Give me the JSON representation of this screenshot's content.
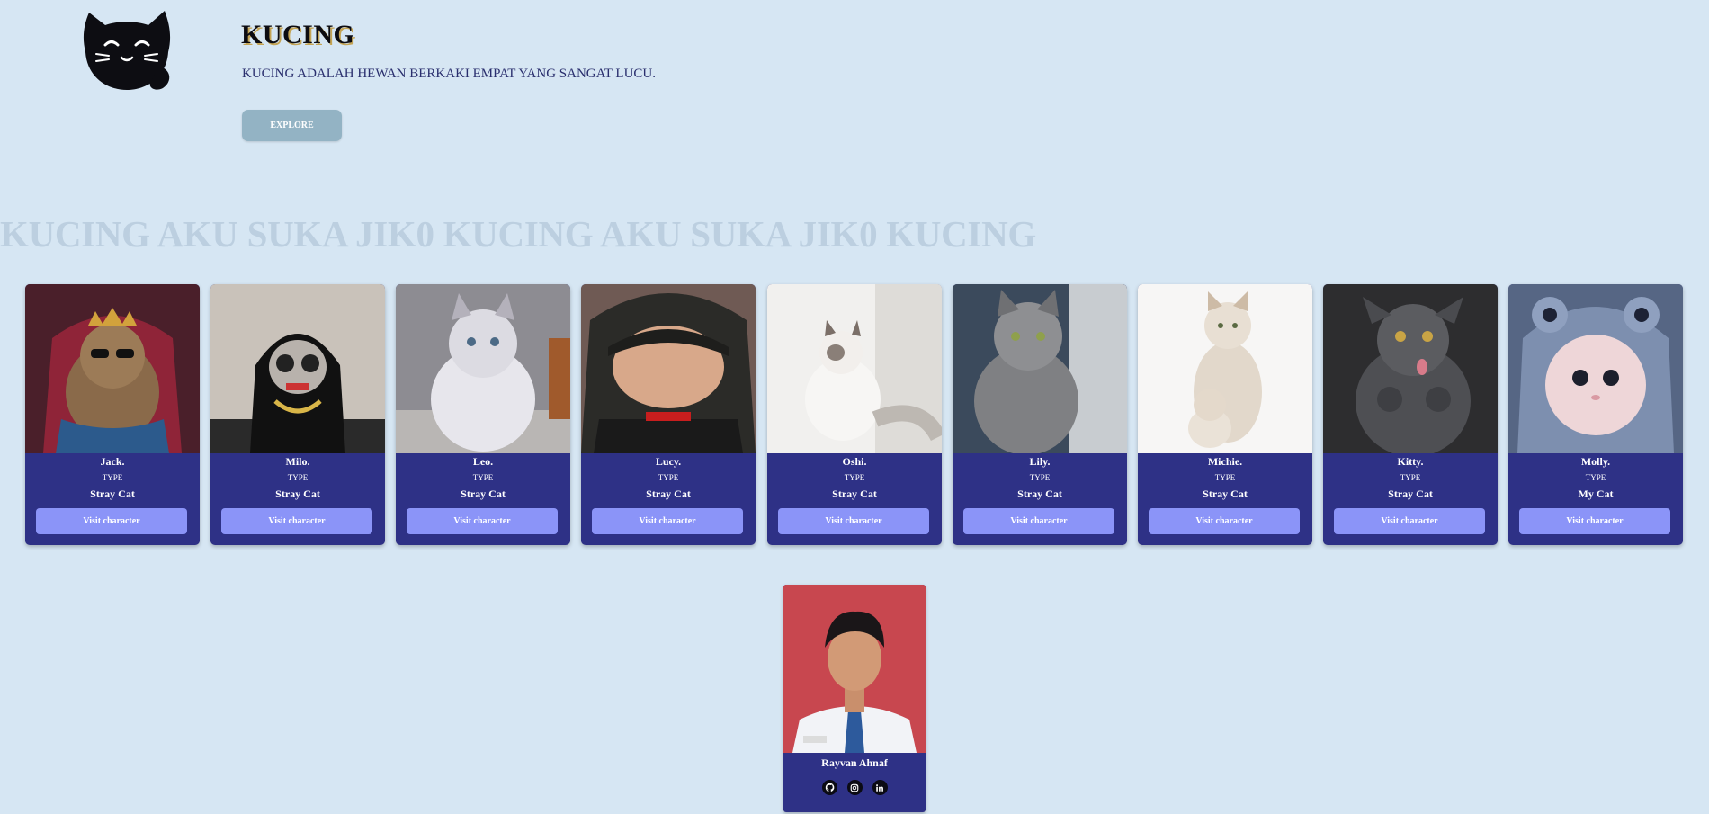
{
  "header": {
    "title": "KUCING",
    "subtitle": "KUCING ADALAH HEWAN BERKAKI EMPAT YANG SANGAT LUCU.",
    "explore_label": "EXPLORE"
  },
  "marquee": {
    "text": "KUCING AKU SUKA JIK0 KUCING AKU SUKA JIK0 KUCING"
  },
  "cards": [
    {
      "name": "Jack.",
      "type_label": "TYPE",
      "type": "Stray Cat",
      "button": "Visit character"
    },
    {
      "name": "Milo.",
      "type_label": "TYPE",
      "type": "Stray Cat",
      "button": "Visit character"
    },
    {
      "name": "Leo.",
      "type_label": "TYPE",
      "type": "Stray Cat",
      "button": "Visit character"
    },
    {
      "name": "Lucy.",
      "type_label": "TYPE",
      "type": "Stray Cat",
      "button": "Visit character"
    },
    {
      "name": "Oshi.",
      "type_label": "TYPE",
      "type": "Stray Cat",
      "button": "Visit character"
    },
    {
      "name": "Lily.",
      "type_label": "TYPE",
      "type": "Stray Cat",
      "button": "Visit character"
    },
    {
      "name": "Michie.",
      "type_label": "TYPE",
      "type": "Stray Cat",
      "button": "Visit character"
    },
    {
      "name": "Kitty.",
      "type_label": "TYPE",
      "type": "Stray Cat",
      "button": "Visit character"
    },
    {
      "name": "Molly.",
      "type_label": "TYPE",
      "type": "My Cat",
      "button": "Visit character"
    }
  ],
  "profile": {
    "name": "Rayvan Ahnaf",
    "socials": [
      "github-icon",
      "instagram-icon",
      "linkedin-icon"
    ]
  },
  "colors": {
    "background": "#d6e6f3",
    "card": "#2e3186",
    "button": "#8b94f8",
    "explore": "#93b3c4"
  }
}
